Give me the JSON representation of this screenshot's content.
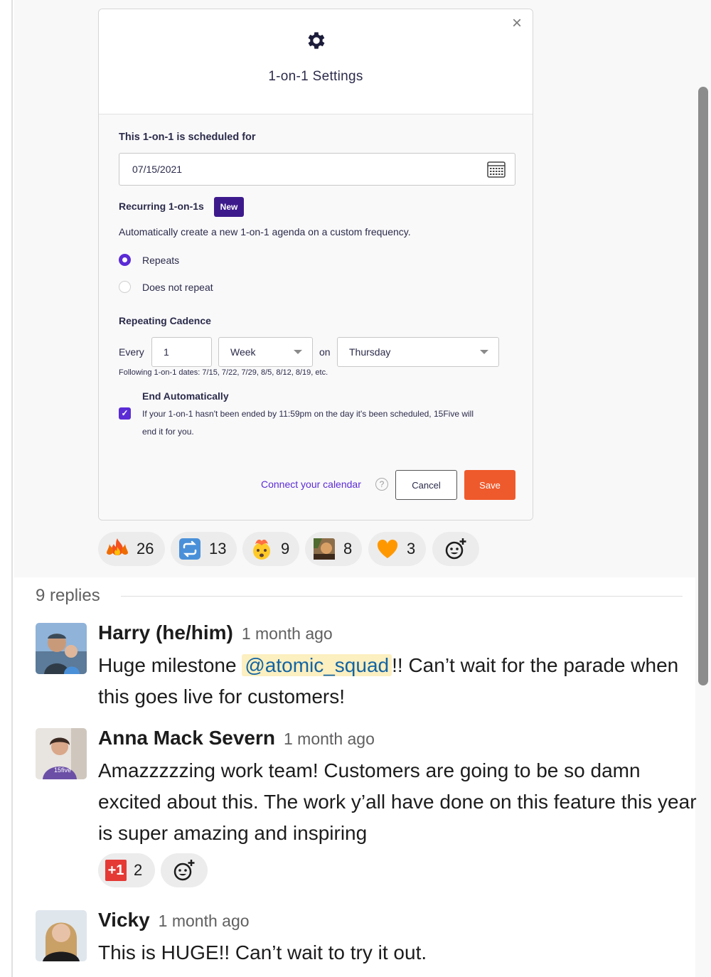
{
  "modal": {
    "title": "1-on-1 Settings",
    "close_label": "×",
    "scheduled_label": "This 1-on-1 is scheduled for",
    "date_value": "07/15/2021",
    "recurring_label": "Recurring 1-on-1s",
    "new_badge": "New",
    "recurring_desc": "Automatically create a new 1-on-1 agenda on a custom frequency.",
    "option_repeats": "Repeats",
    "option_no_repeat": "Does not repeat",
    "cadence_label": "Repeating Cadence",
    "every_label": "Every",
    "every_value": "1",
    "period_value": "Week",
    "on_label": "on",
    "day_value": "Thursday",
    "following_dates": "Following 1-on-1 dates: 7/15, 7/22, 7/29, 8/5, 8/12, 8/19, etc.",
    "end_auto_label": "End Automatically",
    "end_auto_desc_1": "If your 1-on-1 hasn't been ended by 11:59pm on the day it's been scheduled, 15Five will",
    "end_auto_desc_2": "end it for you.",
    "connect_calendar": "Connect your calendar",
    "help_icon": "?",
    "cancel": "Cancel",
    "save": "Save"
  },
  "reactions": [
    {
      "icon": "fire-icon",
      "count": "26"
    },
    {
      "icon": "repeat-icon",
      "count": "13"
    },
    {
      "icon": "mind-blown-icon",
      "count": "9"
    },
    {
      "icon": "custom-emoji-icon",
      "count": "8"
    },
    {
      "icon": "orange-heart-icon",
      "count": "3"
    }
  ],
  "thread": {
    "replies_count": "9 replies",
    "messages": [
      {
        "author": "Harry (he/him)",
        "time": "1 month ago",
        "text_before": "Huge milestone ",
        "mention": "@atomic_squad",
        "text_after": "!! Can’t wait for the parade when this goes live for customers!"
      },
      {
        "author": "Anna Mack Severn",
        "time": "1 month ago",
        "text": "Amazzzzzing work team! Customers are going to be so damn excited about this. The work y’all have done on this feature this year is super amazing and inspiring",
        "reaction_label": "+1",
        "reaction_count": "2"
      },
      {
        "author": "Vicky",
        "time": "1 month ago",
        "text": "This is HUGE!! Can’t wait to try it out."
      }
    ]
  },
  "colors": {
    "accent": "#5b2bd6",
    "save": "#ef5a2c",
    "badge": "#3d1a8c",
    "mention_bg": "#fcefc0",
    "mention_text": "#1264a3"
  }
}
